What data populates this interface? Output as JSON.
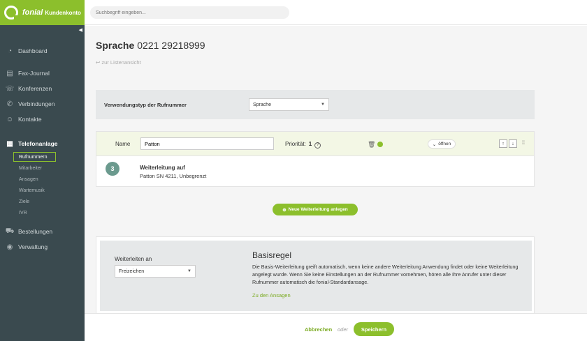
{
  "brand": {
    "name": "fonial",
    "sub": "Kundenkonto"
  },
  "search": {
    "placeholder": "Suchbegriff eingeben..."
  },
  "nav": {
    "dashboard": "Dashboard",
    "fax": "Fax-Journal",
    "konferenzen": "Konferenzen",
    "verbindungen": "Verbindungen",
    "kontakte": "Kontakte",
    "telefonanlage": "Telefonanlage",
    "sub": [
      "Rufnummern",
      "Mitarbeiter",
      "Ansagen",
      "Wartemusik",
      "Ziele",
      "IVR"
    ],
    "bestellungen": "Bestellungen",
    "verwaltung": "Verwaltung"
  },
  "page": {
    "title": "Sprache",
    "number": "0221 29218999",
    "back": "zur Listenansicht"
  },
  "usage": {
    "label": "Verwendungstyp der Rufnummer",
    "value": "Sprache"
  },
  "rule": {
    "name_label": "Name",
    "name_value": "Patton",
    "priority_label": "Priorität:",
    "priority_value": "1",
    "open_label": "öffnen",
    "step": "3",
    "fw_title": "Weiterleitung auf",
    "fw_detail": "Patton SN 4211, Unbegrenzt"
  },
  "add_button": "Neue Weiterleitung anlegen",
  "basis": {
    "forward_label": "Weiterleiten an",
    "forward_value": "Freizeichen",
    "title": "Basisregel",
    "text": "Die Basis-Weiterleitung greift automatisch, wenn keine andere Weiterleitung Anwendung findet oder keine Weiterleitung angelegt wurde. Wenn Sie keine Einstellungen an der Rufnummer vornehmen, hören alle Ihre Anrufer unter dieser Rufnummer automatisch die fonial-Standardansage.",
    "link": "Zu den Ansagen"
  },
  "footer": {
    "cancel": "Abbrechen",
    "or": "oder",
    "save": "Speichern"
  },
  "colors": {
    "accent": "#8cbf2c",
    "sidebar": "#3a4a4f"
  }
}
